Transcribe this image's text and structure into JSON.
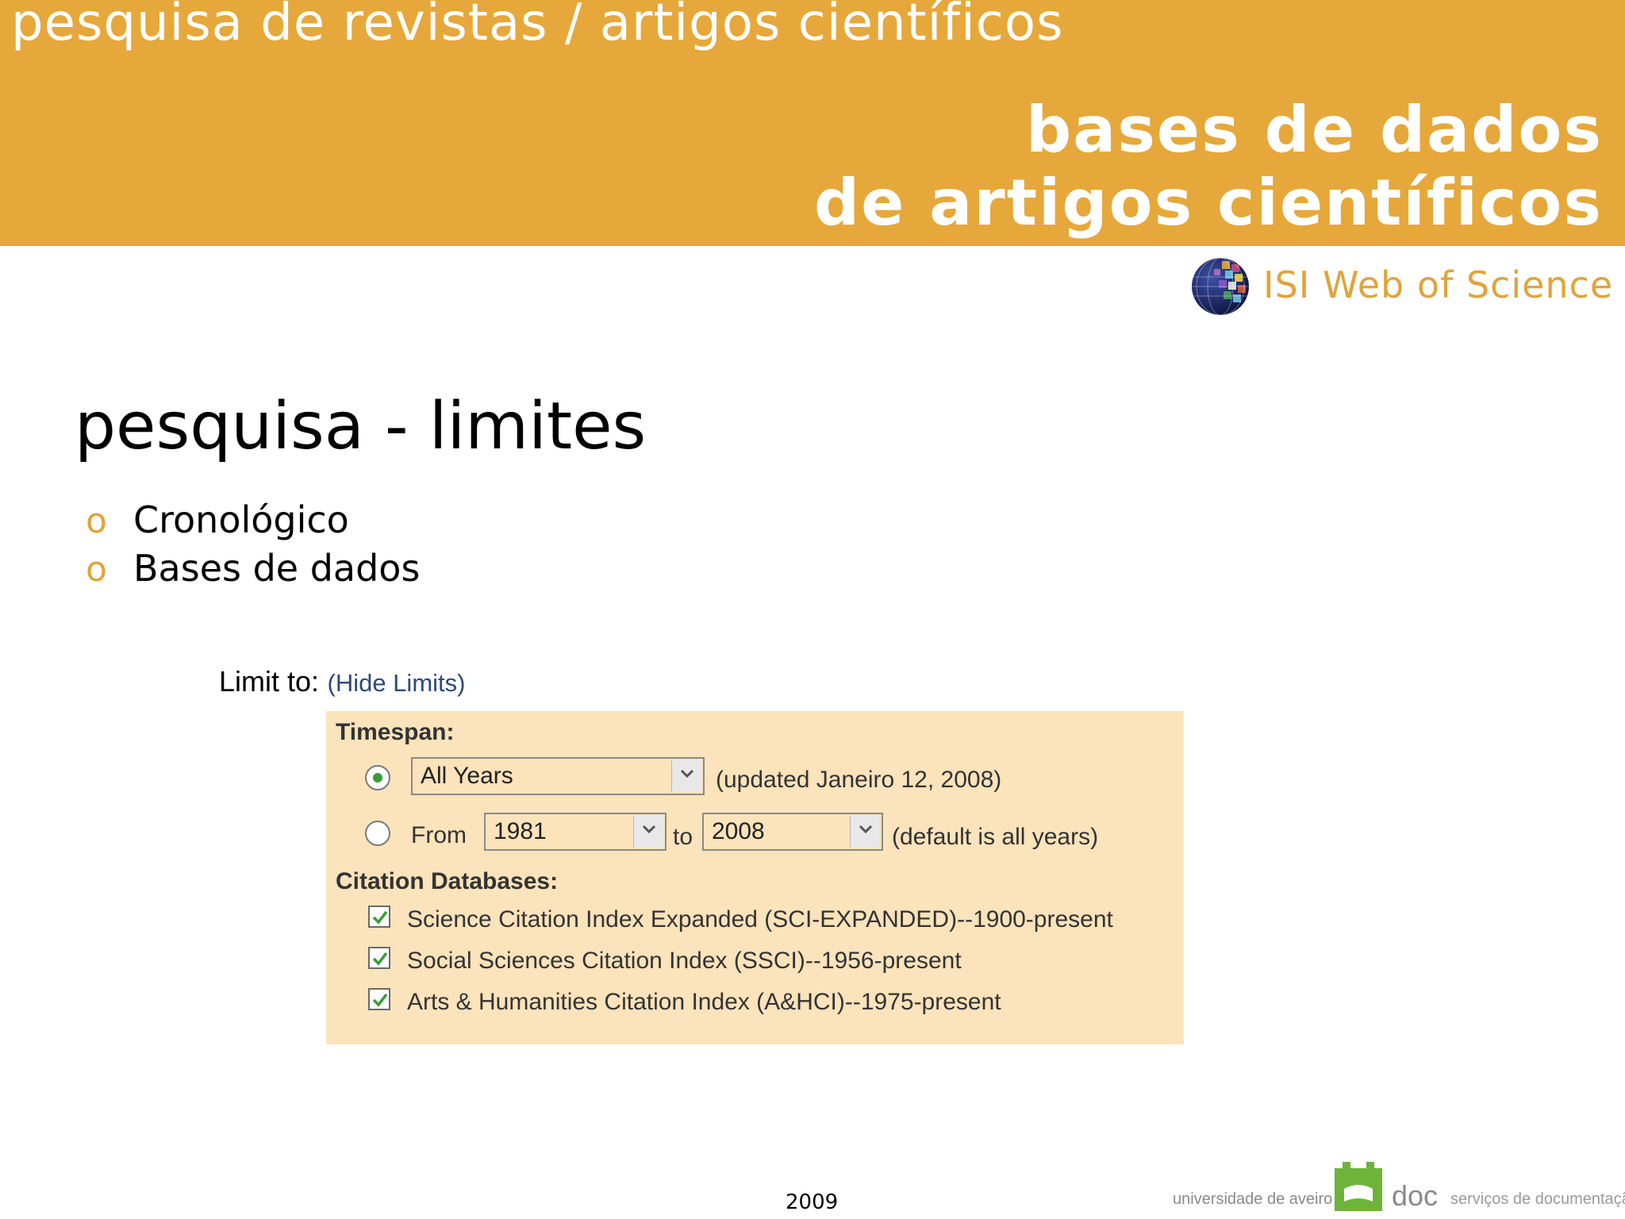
{
  "header": {
    "top_title": "pesquisa de revistas / artigos científicos",
    "main_line1": "bases de dados",
    "main_line2": "de artigos científicos"
  },
  "brand": {
    "isi_logo_icon": "globe-grid-icon",
    "isi_name": "ISI Web of Science"
  },
  "section": {
    "title": "pesquisa - limites",
    "bullets": [
      "Cronológico",
      "Bases de dados"
    ],
    "bullet_mark": "o"
  },
  "limits": {
    "label": "Limit to:",
    "hide_link": "(Hide Limits)",
    "timespan_heading": "Timespan:",
    "all_years_selected": true,
    "all_years_value": "All Years",
    "updated_note": "(updated Janeiro 12, 2008)",
    "from_label": "From",
    "from_value": "1981",
    "to_label": "to",
    "to_value": "2008",
    "default_note": "(default is all years)",
    "citation_heading": "Citation Databases:",
    "databases": [
      {
        "label": "Science Citation Index Expanded (SCI-EXPANDED)--1900-present",
        "checked": true
      },
      {
        "label": "Social Sciences Citation Index (SSCI)--1956-present",
        "checked": true
      },
      {
        "label": "Arts & Humanities Citation Index (A&HCI)--1975-present",
        "checked": true
      }
    ]
  },
  "footer": {
    "year": "2009",
    "university": "universidade de aveiro",
    "doc": "doc",
    "services": "serviços de documentação"
  },
  "colors": {
    "header_band": "#e6a83a",
    "accent_text": "#e1a43a",
    "panel_bg": "#fbe3bb",
    "footer_logo_green": "#6fb43a"
  }
}
